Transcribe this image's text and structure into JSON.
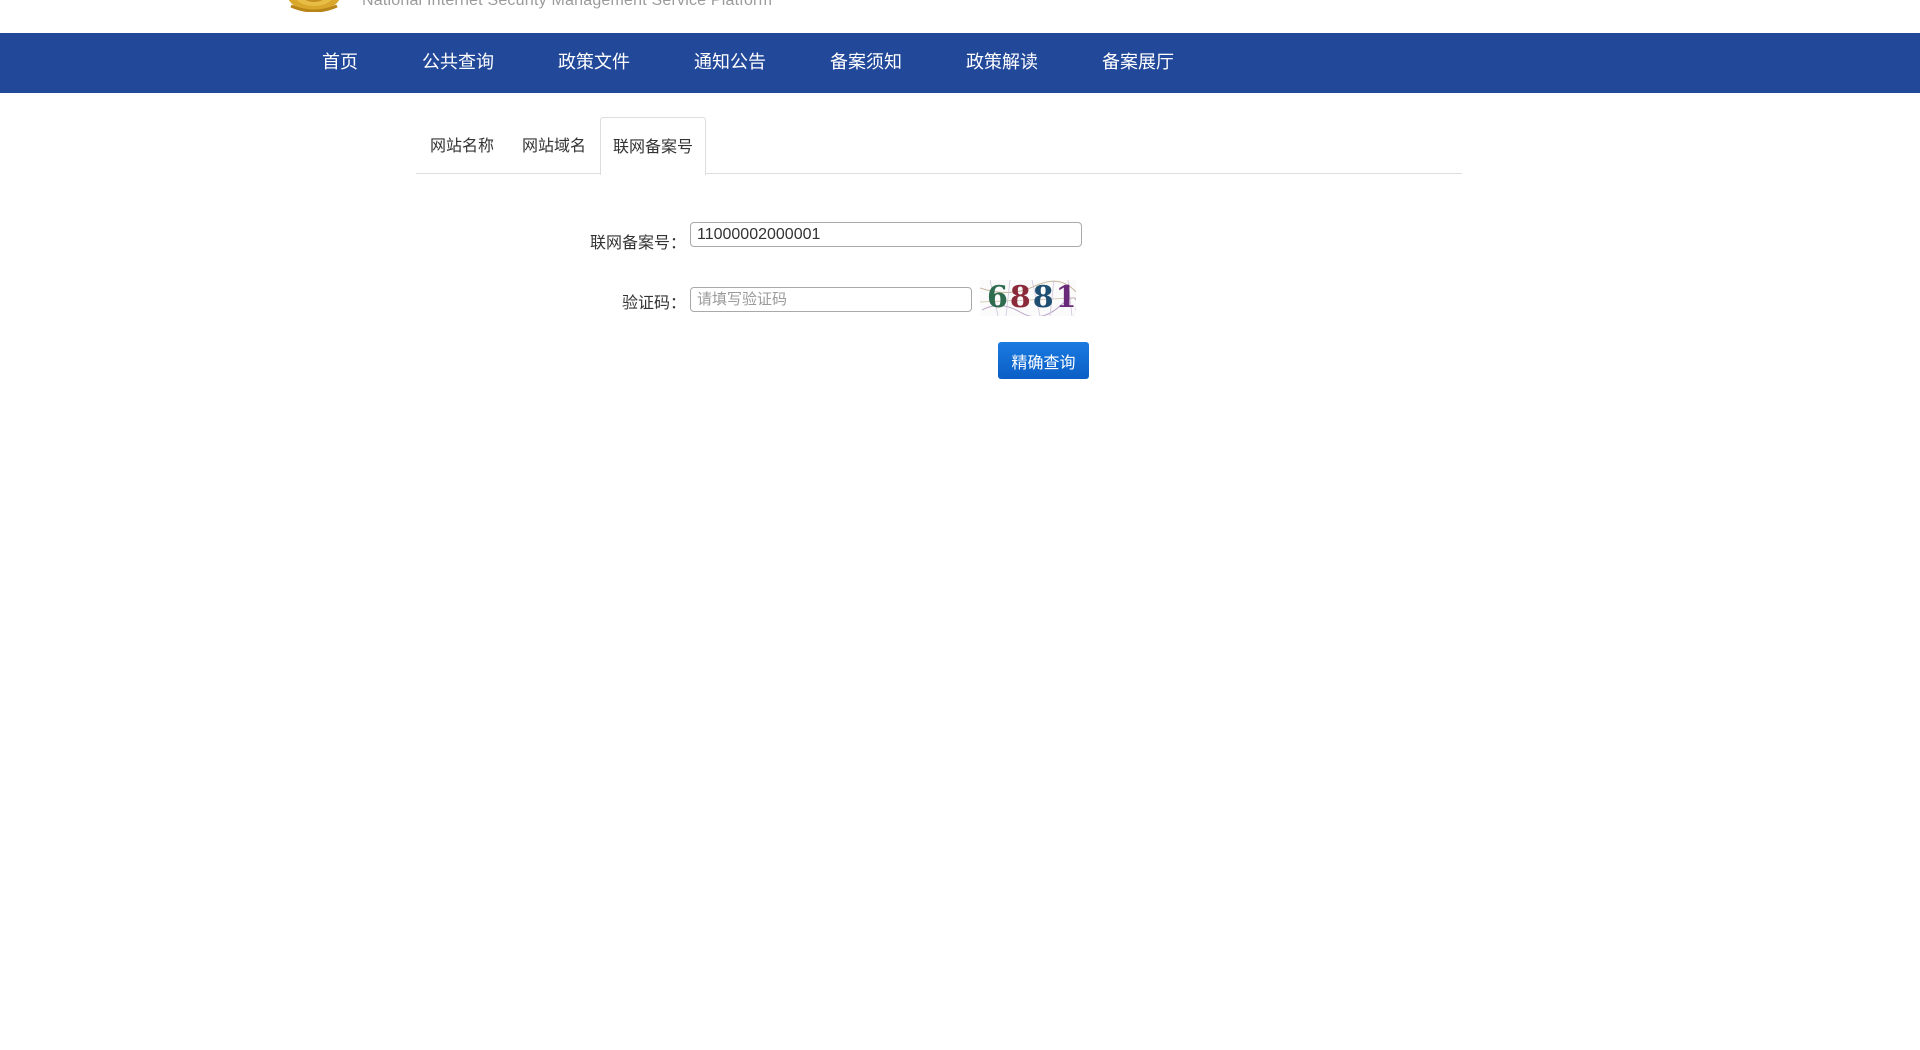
{
  "header": {
    "subtitle": "National Internet Security Management Service Platform",
    "emblem_icon": "police-emblem-icon"
  },
  "nav": {
    "items": [
      {
        "label": "首页"
      },
      {
        "label": "公共查询"
      },
      {
        "label": "政策文件"
      },
      {
        "label": "通知公告"
      },
      {
        "label": "备案须知"
      },
      {
        "label": "政策解读"
      },
      {
        "label": "备案展厅"
      }
    ]
  },
  "tabs": {
    "items": [
      {
        "label": "网站名称"
      },
      {
        "label": "网站域名"
      },
      {
        "label": "联网备案号"
      }
    ],
    "active_index": 2
  },
  "form": {
    "beian_label": "联网备案号：",
    "beian_value": "11000002000001",
    "captcha_label": "验证码：",
    "captcha_placeholder": "请填写验证码",
    "captcha_code": "6881",
    "submit_label": "精确查询"
  },
  "colors": {
    "nav_background": "#22489a",
    "button_background": "#0b5ec6",
    "captcha_digits": [
      "#2e6b4f",
      "#8b2a3a",
      "#1f4e73",
      "#6a2a7a"
    ]
  }
}
